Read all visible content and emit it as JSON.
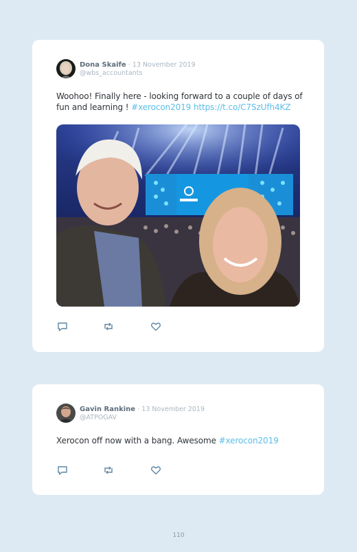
{
  "tweets": [
    {
      "author_name": "Dona Skaife",
      "date": "· 13 November 2019",
      "handle": "@wbs_accountants",
      "text_plain": "Woohoo! Finally here - looking forward to a couple of days of fun and learning ! ",
      "hashtag": "#xerocon2019",
      "link": "https://t.co/C7SzUfh4KZ"
    },
    {
      "author_name": "Gavin Rankine",
      "date": "· 13 November 2019",
      "handle": "@ATPOGAV",
      "text_plain": "Xerocon off now with a bang. Awesome ",
      "hashtag": "#xerocon2019"
    }
  ],
  "icons": {
    "reply": "reply-icon",
    "retweet": "retweet-icon",
    "like": "heart-icon"
  },
  "colors": {
    "background": "#ddeaf3",
    "card": "#ffffff",
    "accent_link": "#5bbde8",
    "name": "#5d6d7b",
    "muted": "#a9b6c1",
    "icon": "#5e86a3"
  },
  "page_number": "110"
}
